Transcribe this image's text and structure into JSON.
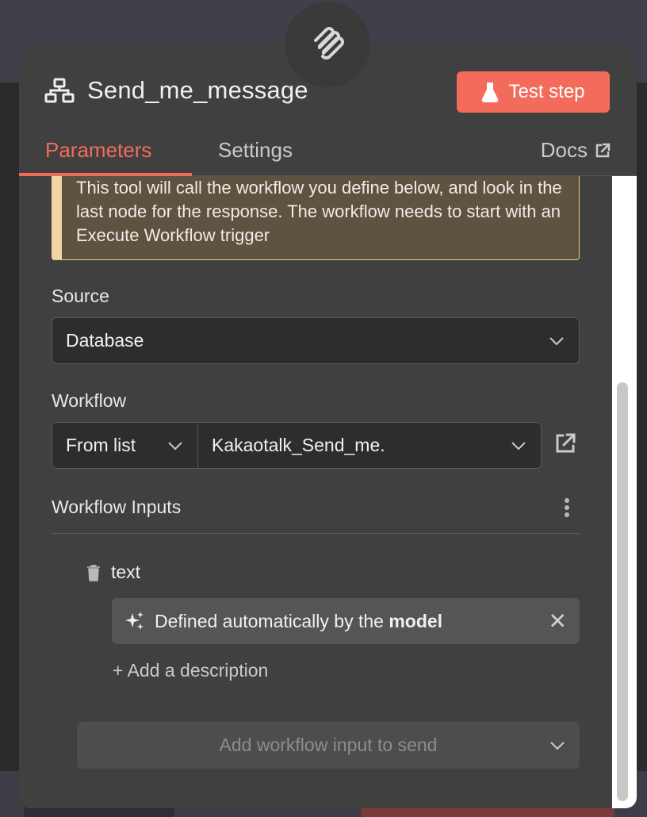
{
  "node": {
    "title": "Send_me_message",
    "test_button_label": "Test step"
  },
  "tabs": {
    "parameters": "Parameters",
    "settings": "Settings",
    "docs": "Docs"
  },
  "notice": {
    "text": "This tool will call the workflow you define below, and look in the last node for the response. The workflow needs to start with an Execute Workflow trigger"
  },
  "source": {
    "label": "Source",
    "value": "Database"
  },
  "workflow": {
    "label": "Workflow",
    "mode_value": "From list",
    "workflow_value": "Kakaotalk_Send_me."
  },
  "workflow_inputs": {
    "title": "Workflow Inputs",
    "items": [
      {
        "name": "text",
        "value_prefix": "Defined automatically by the ",
        "value_bold": "model"
      }
    ],
    "add_description": "+ Add a description",
    "add_input_placeholder": "Add workflow input to send"
  },
  "colors": {
    "accent": "#f26b5b",
    "notice_bg": "#5e5240",
    "notice_border": "#f1d5a4",
    "panel_bg": "#404040"
  }
}
